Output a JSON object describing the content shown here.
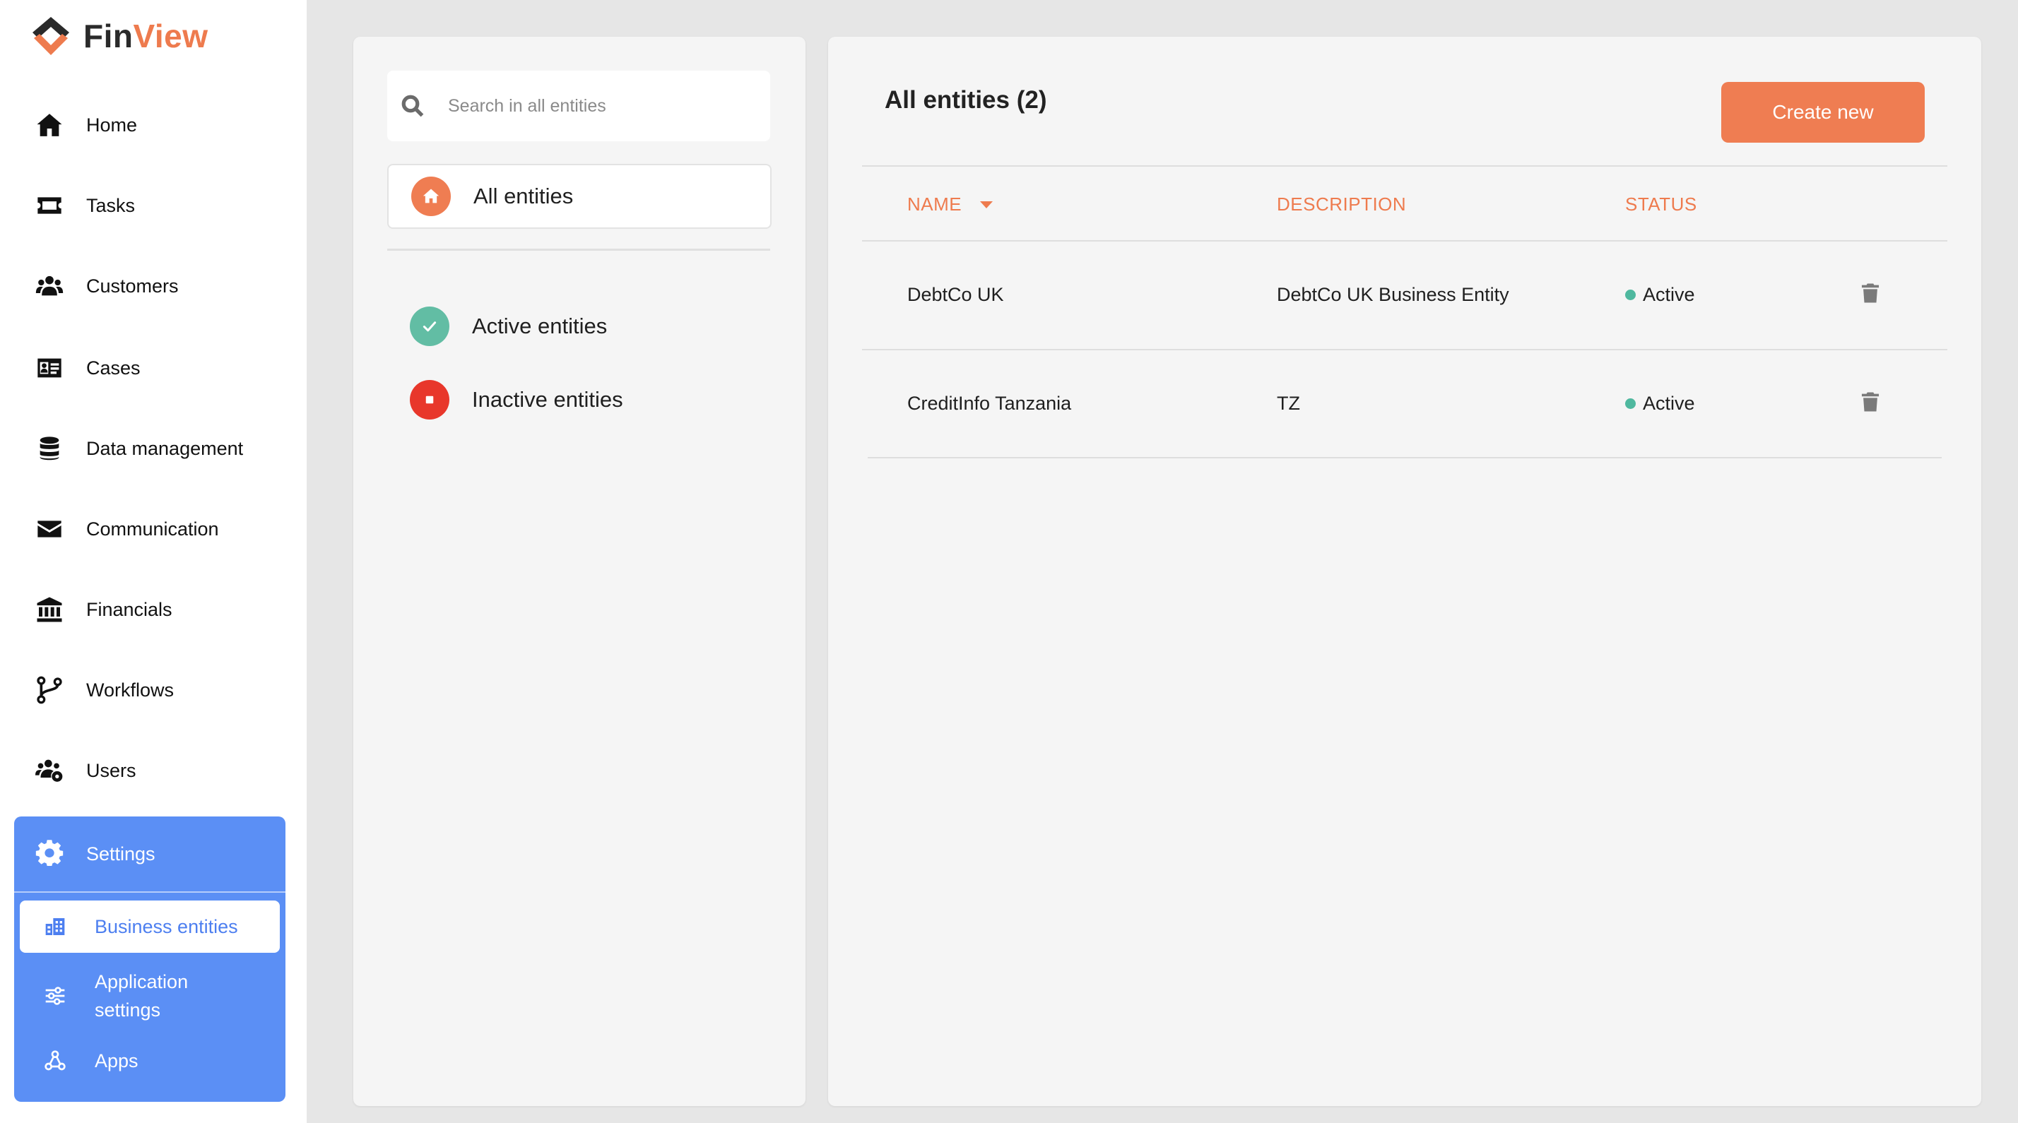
{
  "brand": {
    "name_part1": "Fin",
    "name_part2": "View",
    "accent_color": "#ee7b4e",
    "primary_color": "#5b8ff5"
  },
  "sidebar": {
    "items": [
      {
        "label": "Home",
        "icon": "home-icon"
      },
      {
        "label": "Tasks",
        "icon": "ticket-icon"
      },
      {
        "label": "Customers",
        "icon": "users-icon"
      },
      {
        "label": "Cases",
        "icon": "id-card-icon"
      },
      {
        "label": "Data management",
        "icon": "database-icon"
      },
      {
        "label": "Communication",
        "icon": "envelope-icon"
      },
      {
        "label": "Financials",
        "icon": "bank-icon"
      },
      {
        "label": "Workflows",
        "icon": "branch-icon"
      },
      {
        "label": "Users",
        "icon": "users-gear-icon"
      }
    ],
    "settings": {
      "label": "Settings",
      "icon": "gear-icon",
      "subitems": [
        {
          "label": "Business entities",
          "icon": "building-icon",
          "active": true
        },
        {
          "label": "Application settings",
          "icon": "sliders-icon"
        },
        {
          "label": "Apps",
          "icon": "webhook-icon"
        }
      ]
    }
  },
  "filters": {
    "search_placeholder": "Search in all entities",
    "all": "All entities",
    "active": "Active entities",
    "inactive": "Inactive entities"
  },
  "main": {
    "title": "All entities (2)",
    "create_button": "Create new",
    "columns": {
      "name": "NAME",
      "description": "DESCRIPTION",
      "status": "STATUS"
    },
    "rows": [
      {
        "name": "DebtCo UK",
        "description": "DebtCo UK Business Entity",
        "status": "Active"
      },
      {
        "name": "CreditInfo Tanzania",
        "description": "TZ",
        "status": "Active"
      }
    ]
  }
}
